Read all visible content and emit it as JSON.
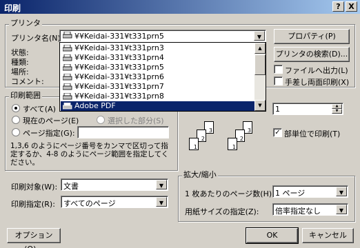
{
  "title": "印刷",
  "title_buttons": [
    "?",
    "X"
  ],
  "printer_group": {
    "legend": "プリンタ",
    "name_label": "プリンタ名(N):",
    "selected_printer": "¥¥Keidai-331¥t331prn5",
    "status_label": "状態:",
    "type_label": "種類:",
    "location_label": "場所:",
    "comment_label": "コメント:",
    "dropdown_items": [
      "¥¥Keidai-331¥t331prn3",
      "¥¥Keidai-331¥t331prn4",
      "¥¥Keidai-331¥t331prn5",
      "¥¥Keidai-331¥t331prn6",
      "¥¥Keidai-331¥t331prn7",
      "¥¥Keidai-331¥t331prn8",
      "Adobe PDF"
    ],
    "highlighted_item": "Adobe PDF",
    "properties_button": "プロパティ(P)",
    "find_printer_button": "プリンタの検索(D)...",
    "print_to_file": {
      "label": "ファイルへ出力(L)",
      "checked": false
    },
    "manual_duplex": {
      "label": "手差し両面印刷(X)",
      "checked": false
    }
  },
  "range_group": {
    "legend": "印刷範囲",
    "all": {
      "label": "すべて(A)",
      "selected": true
    },
    "current_page": {
      "label": "現在のページ(E)",
      "selected": false
    },
    "selection": {
      "label": "選択した部分(S)",
      "selected": false
    },
    "pages": {
      "label": "ページ指定(G):",
      "selected": false,
      "value": ""
    },
    "help_text": "1,3,6 のようにページ番号をカンマで区切って指定するか、4-8 のようにページ範囲を指定してください。"
  },
  "copies": {
    "value": "1",
    "collate": {
      "label": "部単位で印刷(T)",
      "checked": true
    },
    "page_numbers": [
      "1",
      "2",
      "3"
    ]
  },
  "print_what": {
    "label": "印刷対象(W):",
    "value": "文書"
  },
  "print_option": {
    "label": "印刷指定(R):",
    "value": "すべてのページ"
  },
  "zoom_group": {
    "legend": "拡大/縮小",
    "pages_per_sheet": {
      "label": "1 枚あたりのページ数(H):",
      "value": "1 ページ"
    },
    "scale_to_paper": {
      "label": "用紙サイズの指定(Z):",
      "value": "倍率指定なし"
    }
  },
  "footer": {
    "options_button": "オプション(O)...",
    "ok_button": "OK",
    "cancel_button": "キャンセル"
  },
  "colors": {
    "title_start": "#0a246a",
    "title_end": "#a6caf0",
    "selection": "#0a246a",
    "dialog": "#d4d0c8"
  }
}
